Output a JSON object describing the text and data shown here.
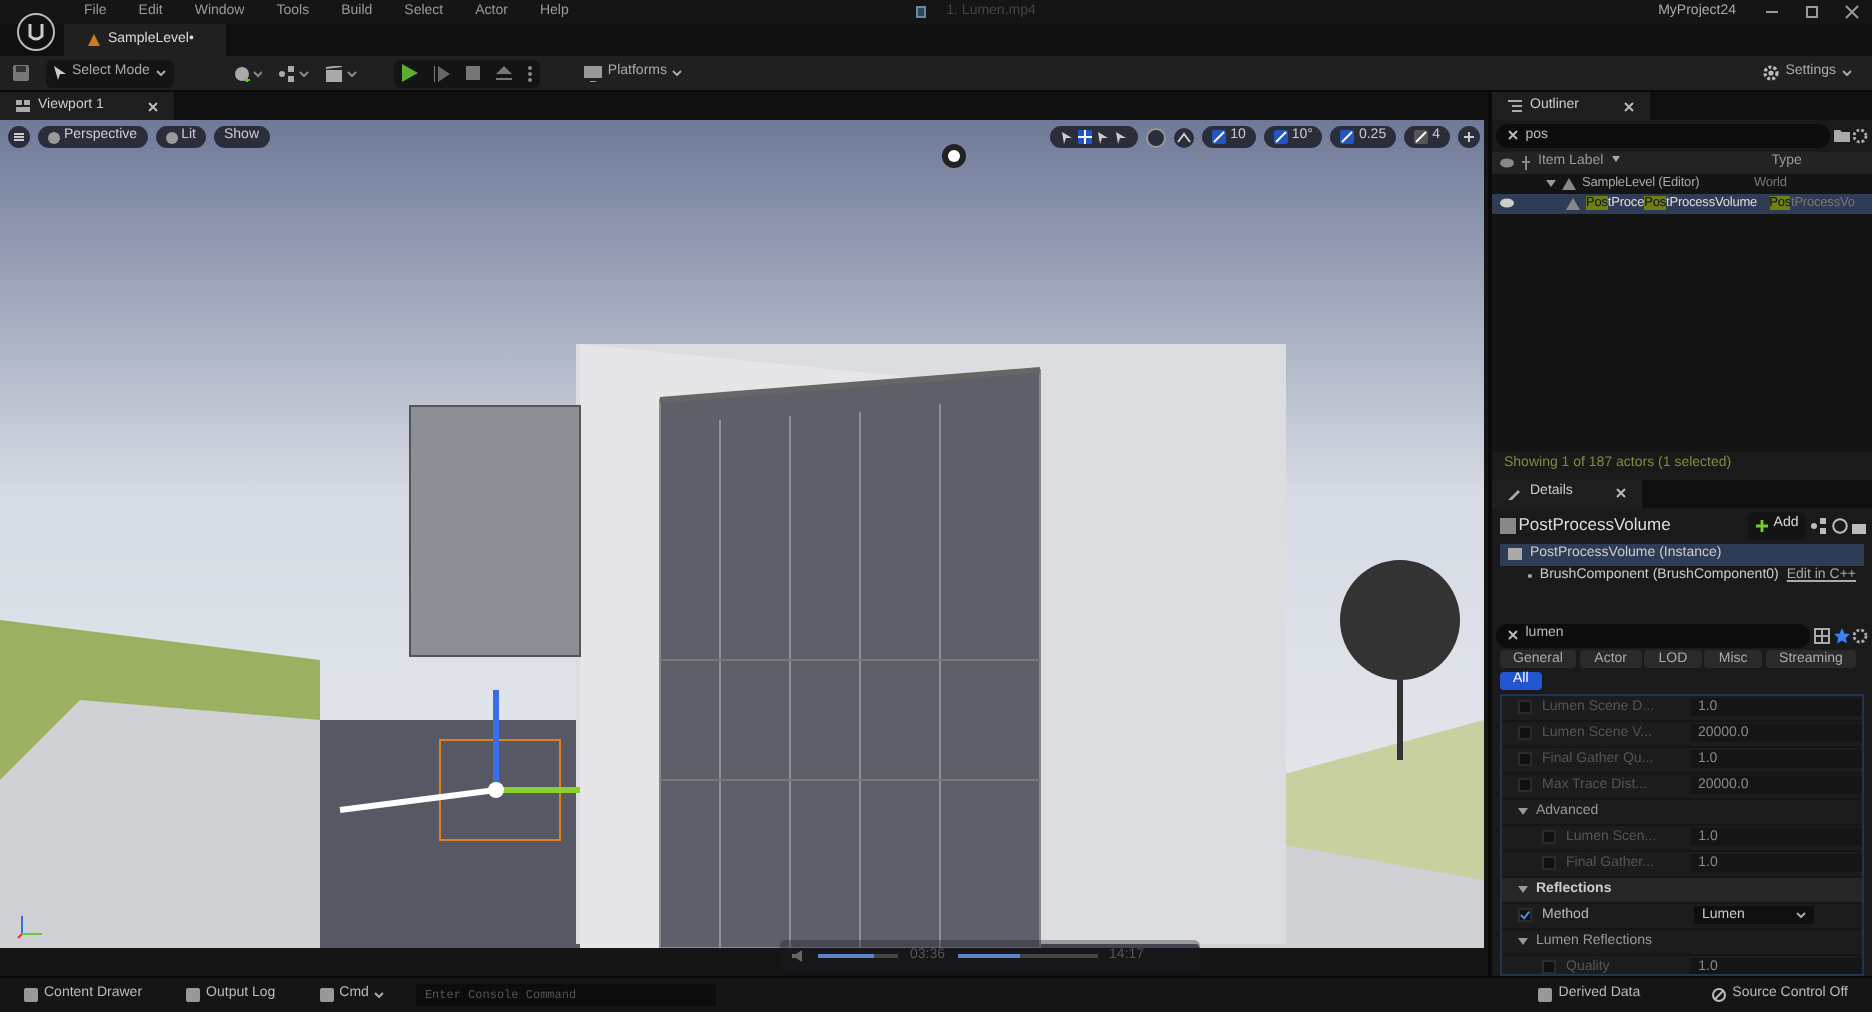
{
  "menu": [
    "File",
    "Edit",
    "Window",
    "Tools",
    "Build",
    "Select",
    "Actor",
    "Help"
  ],
  "window": {
    "document": "1. Lumen.mp4",
    "project": "MyProject24"
  },
  "level_tab": {
    "label": "SampleLevel•"
  },
  "toolbar": {
    "mode": "Select Mode",
    "platforms": "Platforms",
    "settings": "Settings"
  },
  "viewport": {
    "tab": "Viewport 1",
    "view_buttons": [
      "Perspective",
      "Lit",
      "Show"
    ],
    "grid_snap": "10",
    "rotation_snap": "10°",
    "scale_snap": "0.25",
    "camera_speed": "4"
  },
  "player": {
    "elapsed": "03:36",
    "total": "14:17",
    "level": 0.45,
    "volume_slider": {
      "level": 0.7
    }
  },
  "outliner": {
    "title": "Outliner",
    "search": "pos",
    "columns": [
      "Item Label",
      "Type"
    ],
    "rows": [
      {
        "label": [
          {
            "text": "SampleLevel (Editor)",
            "match": false
          }
        ],
        "type": [
          {
            "text": "World",
            "match": false
          }
        ],
        "selected": false,
        "children": [
          {
            "label": [
              {
                "text": "Pos",
                "match": true
              },
              {
                "text": "tProce",
                "match": false
              },
              {
                "text": "Pos",
                "match": true
              },
              {
                "text": "tProcessVolume",
                "match": false
              }
            ],
            "type": [
              {
                "text": "Pos",
                "match": true
              },
              {
                "text": "tProcessVo",
                "match": false
              }
            ],
            "selected": true
          }
        ]
      }
    ],
    "footer": "Showing 1 of 187 actors (1 selected)"
  },
  "details": {
    "title": "Details",
    "actor": "PostProcessVolume",
    "add": "Add",
    "components": [
      {
        "label": "PostProcessVolume (Instance)",
        "selected": true
      },
      {
        "label": "BrushComponent (BrushComponent0)",
        "selected": false,
        "link": "Edit in C++"
      }
    ],
    "search": "lumen",
    "filters": [
      {
        "label": "General",
        "selected": false
      },
      {
        "label": "Actor",
        "selected": false
      },
      {
        "label": "LOD",
        "selected": false
      },
      {
        "label": "Misc",
        "selected": false
      },
      {
        "label": "Streaming",
        "selected": false
      },
      {
        "label": "All",
        "selected": true
      }
    ],
    "properties": [
      {
        "kind": "property",
        "name": "Lumen Scene D...",
        "value": "1.0",
        "checked": false
      },
      {
        "kind": "property",
        "name": "Lumen Scene V...",
        "value": "20000.0",
        "checked": false
      },
      {
        "kind": "property",
        "name": "Final Gather Qu...",
        "value": "1.0",
        "checked": false
      },
      {
        "kind": "property",
        "name": "Max Trace Dist...",
        "value": "20000.0",
        "checked": false
      },
      {
        "kind": "group",
        "name": "Advanced",
        "expanded": true,
        "children": [
          {
            "kind": "property",
            "name": "Lumen Scen...",
            "value": "1.0",
            "checked": false
          },
          {
            "kind": "property",
            "name": "Final Gather...",
            "value": "1.0",
            "checked": false
          }
        ]
      },
      {
        "kind": "category",
        "name": "Reflections",
        "expanded": true
      },
      {
        "kind": "dropdown",
        "name": "Method",
        "value": "Lumen",
        "checked": true
      },
      {
        "kind": "group",
        "name": "Lumen Reflections",
        "expanded": true,
        "children": [
          {
            "kind": "property",
            "name": "Quality",
            "value": "1.0",
            "checked": false
          }
        ]
      }
    ]
  },
  "status_bar": {
    "content_drawer": "Content Drawer",
    "output_log": "Output Log",
    "cmd": "Cmd",
    "console_placeholder": "Enter Console Command",
    "derived_data": "Derived Data",
    "source_control": "Source Control Off"
  }
}
